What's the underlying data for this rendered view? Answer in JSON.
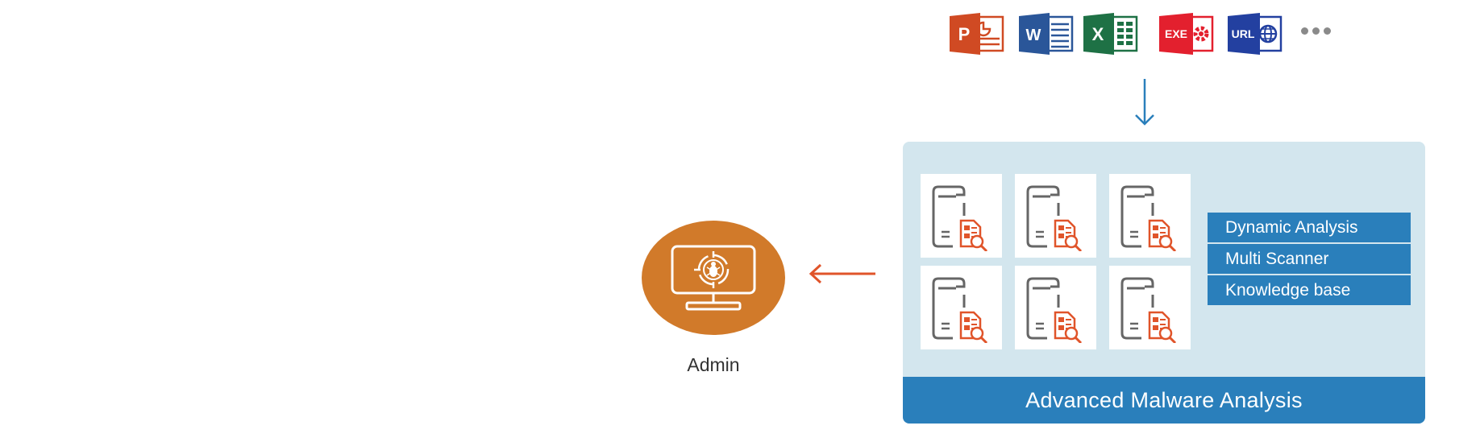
{
  "file_types": [
    {
      "name": "powerpoint",
      "label": "P",
      "color": "#d04a23"
    },
    {
      "name": "word",
      "label": "W",
      "color": "#2a5699"
    },
    {
      "name": "excel",
      "label": "X",
      "color": "#1e7145"
    },
    {
      "name": "exe",
      "label": "EXE",
      "color": "#e3202e"
    },
    {
      "name": "url",
      "label": "URL",
      "color": "#2340a0"
    }
  ],
  "more_indicator": "more-icon",
  "panel": {
    "title": "Advanced Malware Analysis",
    "background": "#d3e6ee",
    "accent": "#2a7fbb",
    "tile_count": 6,
    "features": [
      "Dynamic Analysis",
      "Multi Scanner",
      "Knowledge base"
    ]
  },
  "admin": {
    "label": "Admin",
    "color": "#d17a2a"
  },
  "arrows": {
    "input_color": "#2a7fbb",
    "output_color": "#e0542a"
  }
}
